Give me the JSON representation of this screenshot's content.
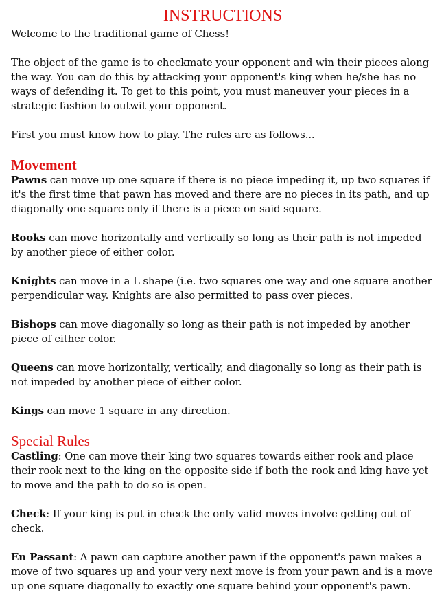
{
  "title": "INSTRUCTIONS",
  "intro": {
    "welcome": "Welcome to the traditional game of Chess!",
    "objective": "The object of the game is to checkmate your opponent and win their pieces along the way. You can do this by attacking your opponent's king when he/she has no ways of defending it. To get to this point, you must maneuver your pieces in a strategic fashion to outwit your opponent.",
    "rules_lead": "First you must know how to play. The rules are as follows..."
  },
  "movement": {
    "heading": "Movement",
    "items": [
      {
        "term": "Pawns",
        "text": " can move up one square if there is no piece impeding it, up two squares if it's the first time that pawn has moved and there are no pieces in its path, and up diagonally one square only if there is a piece on said square."
      },
      {
        "term": "Rooks",
        "text": " can move horizontally and vertically so long as their path is not impeded by another piece of either color."
      },
      {
        "term": "Knights",
        "text": " can move in a L shape (i.e. two squares one way and one square another perpendicular way. Knights are also permitted to pass over pieces."
      },
      {
        "term": "Bishops",
        "text": " can move diagonally so long as their path is not impeded by another piece of either color."
      },
      {
        "term": "Queens",
        "text": " can move horizontally, vertically, and diagonally so long as their path is not impeded by another piece of either color."
      },
      {
        "term": "Kings",
        "text": " can move 1 square in any direction."
      }
    ]
  },
  "special_rules": {
    "heading": "Special Rules",
    "items": [
      {
        "term": "Castling",
        "text": ": One can move their king two squares towards either rook and place their rook next to the king on the opposite side if both the rook and king have yet to move and the path to do so is open."
      },
      {
        "term": "Check",
        "text": ": If your king is put in check the only valid moves involve getting out of check."
      },
      {
        "term": "En Passant",
        "text": ": A pawn can capture another pawn if the opponent's pawn makes a move of two squares up and your very next move is from your pawn and is a move up one square diagonally to exactly one square behind your opponent's pawn."
      }
    ]
  },
  "colors": {
    "heading": "#e01414",
    "text": "#111111",
    "background": "#ffffff"
  }
}
